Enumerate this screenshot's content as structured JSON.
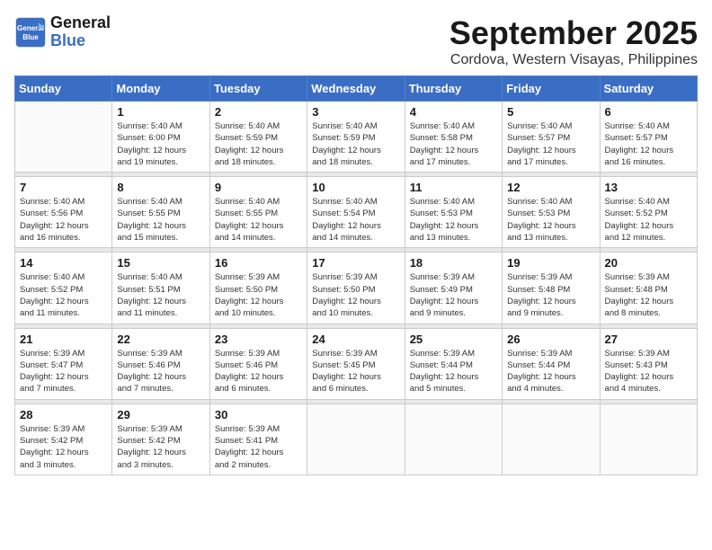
{
  "header": {
    "logo_line1": "General",
    "logo_line2": "Blue",
    "month": "September 2025",
    "location": "Cordova, Western Visayas, Philippines"
  },
  "weekdays": [
    "Sunday",
    "Monday",
    "Tuesday",
    "Wednesday",
    "Thursday",
    "Friday",
    "Saturday"
  ],
  "weeks": [
    [
      {
        "day": "",
        "info": ""
      },
      {
        "day": "1",
        "info": "Sunrise: 5:40 AM\nSunset: 6:00 PM\nDaylight: 12 hours\nand 19 minutes."
      },
      {
        "day": "2",
        "info": "Sunrise: 5:40 AM\nSunset: 5:59 PM\nDaylight: 12 hours\nand 18 minutes."
      },
      {
        "day": "3",
        "info": "Sunrise: 5:40 AM\nSunset: 5:59 PM\nDaylight: 12 hours\nand 18 minutes."
      },
      {
        "day": "4",
        "info": "Sunrise: 5:40 AM\nSunset: 5:58 PM\nDaylight: 12 hours\nand 17 minutes."
      },
      {
        "day": "5",
        "info": "Sunrise: 5:40 AM\nSunset: 5:57 PM\nDaylight: 12 hours\nand 17 minutes."
      },
      {
        "day": "6",
        "info": "Sunrise: 5:40 AM\nSunset: 5:57 PM\nDaylight: 12 hours\nand 16 minutes."
      }
    ],
    [
      {
        "day": "7",
        "info": "Sunrise: 5:40 AM\nSunset: 5:56 PM\nDaylight: 12 hours\nand 16 minutes."
      },
      {
        "day": "8",
        "info": "Sunrise: 5:40 AM\nSunset: 5:55 PM\nDaylight: 12 hours\nand 15 minutes."
      },
      {
        "day": "9",
        "info": "Sunrise: 5:40 AM\nSunset: 5:55 PM\nDaylight: 12 hours\nand 14 minutes."
      },
      {
        "day": "10",
        "info": "Sunrise: 5:40 AM\nSunset: 5:54 PM\nDaylight: 12 hours\nand 14 minutes."
      },
      {
        "day": "11",
        "info": "Sunrise: 5:40 AM\nSunset: 5:53 PM\nDaylight: 12 hours\nand 13 minutes."
      },
      {
        "day": "12",
        "info": "Sunrise: 5:40 AM\nSunset: 5:53 PM\nDaylight: 12 hours\nand 13 minutes."
      },
      {
        "day": "13",
        "info": "Sunrise: 5:40 AM\nSunset: 5:52 PM\nDaylight: 12 hours\nand 12 minutes."
      }
    ],
    [
      {
        "day": "14",
        "info": "Sunrise: 5:40 AM\nSunset: 5:52 PM\nDaylight: 12 hours\nand 11 minutes."
      },
      {
        "day": "15",
        "info": "Sunrise: 5:40 AM\nSunset: 5:51 PM\nDaylight: 12 hours\nand 11 minutes."
      },
      {
        "day": "16",
        "info": "Sunrise: 5:39 AM\nSunset: 5:50 PM\nDaylight: 12 hours\nand 10 minutes."
      },
      {
        "day": "17",
        "info": "Sunrise: 5:39 AM\nSunset: 5:50 PM\nDaylight: 12 hours\nand 10 minutes."
      },
      {
        "day": "18",
        "info": "Sunrise: 5:39 AM\nSunset: 5:49 PM\nDaylight: 12 hours\nand 9 minutes."
      },
      {
        "day": "19",
        "info": "Sunrise: 5:39 AM\nSunset: 5:48 PM\nDaylight: 12 hours\nand 9 minutes."
      },
      {
        "day": "20",
        "info": "Sunrise: 5:39 AM\nSunset: 5:48 PM\nDaylight: 12 hours\nand 8 minutes."
      }
    ],
    [
      {
        "day": "21",
        "info": "Sunrise: 5:39 AM\nSunset: 5:47 PM\nDaylight: 12 hours\nand 7 minutes."
      },
      {
        "day": "22",
        "info": "Sunrise: 5:39 AM\nSunset: 5:46 PM\nDaylight: 12 hours\nand 7 minutes."
      },
      {
        "day": "23",
        "info": "Sunrise: 5:39 AM\nSunset: 5:46 PM\nDaylight: 12 hours\nand 6 minutes."
      },
      {
        "day": "24",
        "info": "Sunrise: 5:39 AM\nSunset: 5:45 PM\nDaylight: 12 hours\nand 6 minutes."
      },
      {
        "day": "25",
        "info": "Sunrise: 5:39 AM\nSunset: 5:44 PM\nDaylight: 12 hours\nand 5 minutes."
      },
      {
        "day": "26",
        "info": "Sunrise: 5:39 AM\nSunset: 5:44 PM\nDaylight: 12 hours\nand 4 minutes."
      },
      {
        "day": "27",
        "info": "Sunrise: 5:39 AM\nSunset: 5:43 PM\nDaylight: 12 hours\nand 4 minutes."
      }
    ],
    [
      {
        "day": "28",
        "info": "Sunrise: 5:39 AM\nSunset: 5:42 PM\nDaylight: 12 hours\nand 3 minutes."
      },
      {
        "day": "29",
        "info": "Sunrise: 5:39 AM\nSunset: 5:42 PM\nDaylight: 12 hours\nand 3 minutes."
      },
      {
        "day": "30",
        "info": "Sunrise: 5:39 AM\nSunset: 5:41 PM\nDaylight: 12 hours\nand 2 minutes."
      },
      {
        "day": "",
        "info": ""
      },
      {
        "day": "",
        "info": ""
      },
      {
        "day": "",
        "info": ""
      },
      {
        "day": "",
        "info": ""
      }
    ]
  ]
}
